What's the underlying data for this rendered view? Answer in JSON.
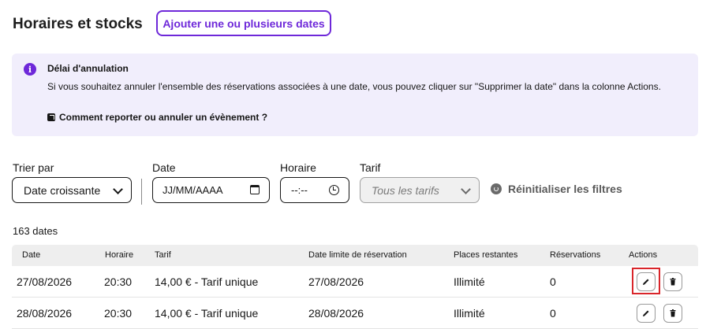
{
  "header": {
    "title": "Horaires et stocks",
    "add_button": "Ajouter une ou plusieurs dates"
  },
  "info_box": {
    "icon": "info-icon",
    "title": "Délai d'annulation",
    "text": "Si vous souhaitez annuler l'ensemble des réservations associées à une date, vous pouvez cliquer sur \"Supprimer la date\" dans la colonne Actions.",
    "link": "Comment reporter ou annuler un évènement ?"
  },
  "filters": {
    "sort_label": "Trier par",
    "sort_value": "Date croissante",
    "date_label": "Date",
    "date_placeholder": "JJ/MM/AAAA",
    "time_label": "Horaire",
    "time_placeholder": "--:--",
    "tarif_label": "Tarif",
    "tarif_value": "Tous les tarifs",
    "reset": "Réinitialiser les filtres"
  },
  "table": {
    "count": "163 dates",
    "columns": [
      "Date",
      "Horaire",
      "Tarif",
      "Date limite de réservation",
      "Places restantes",
      "Réservations",
      "Actions"
    ],
    "rows": [
      {
        "date": "27/08/2026",
        "time": "20:30",
        "tarif": "14,00 € - Tarif unique",
        "limit": "27/08/2026",
        "places": "Illimité",
        "reservations": "0"
      },
      {
        "date": "28/08/2026",
        "time": "20:30",
        "tarif": "14,00 € - Tarif unique",
        "limit": "28/08/2026",
        "places": "Illimité",
        "reservations": "0"
      }
    ]
  },
  "colors": {
    "accent": "#6e28d9",
    "info_background": "#f1eefc",
    "highlight": "#d9252a"
  }
}
